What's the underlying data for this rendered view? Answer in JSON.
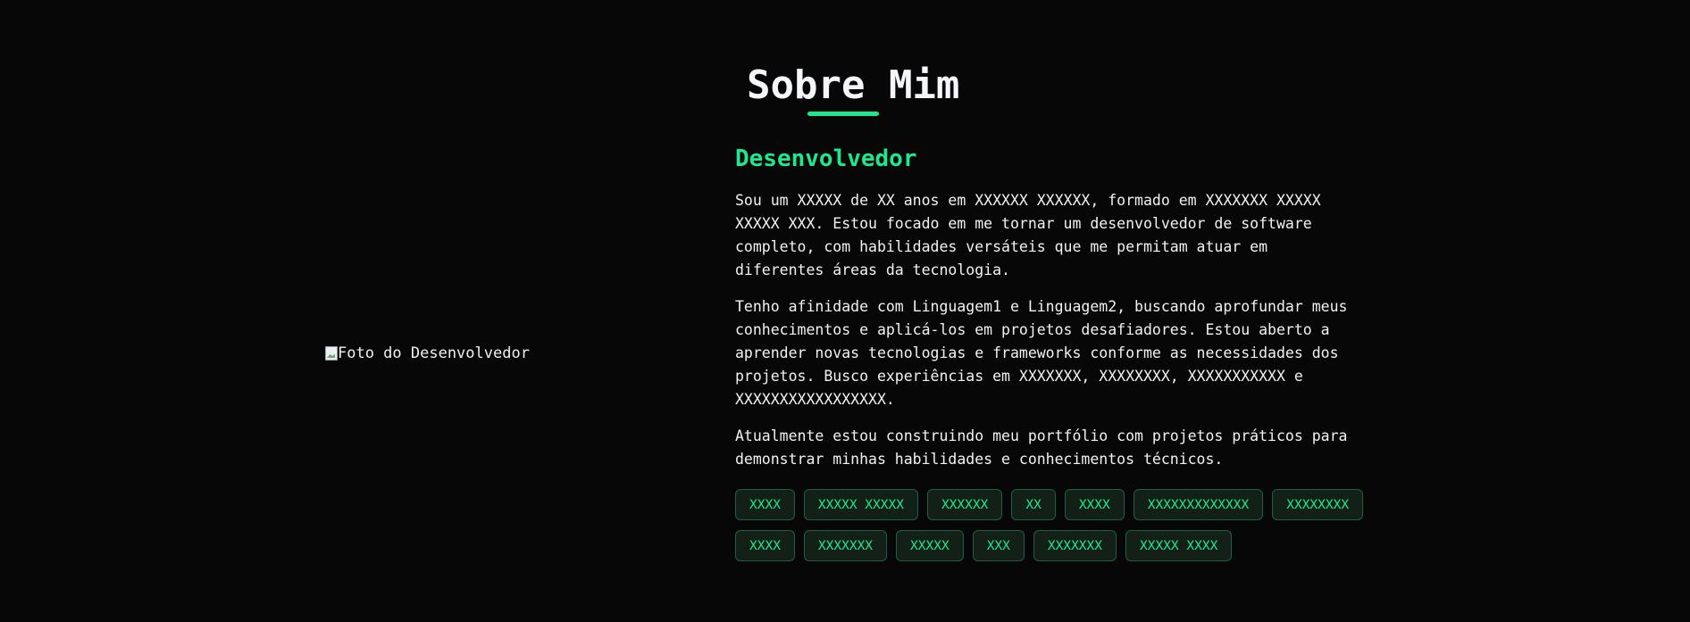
{
  "about": {
    "title": "Sobre Mim",
    "photo_alt": "Foto do Desenvolvedor",
    "subtitle": "Desenvolvedor",
    "paragraphs": [
      "Sou um XXXXX de XX anos em XXXXXX XXXXXX, formado em XXXXXXX XXXXX XXXXX XXX. Estou focado em me tornar um desenvolvedor de software completo, com habilidades versáteis que me permitam atuar em diferentes áreas da tecnologia.",
      "Tenho afinidade com Linguagem1 e Linguagem2, buscando aprofundar meus conhecimentos e aplicá-los em projetos desafiadores. Estou aberto a aprender novas tecnologias e frameworks conforme as necessidades dos projetos. Busco experiências em XXXXXXX, XXXXXXXX, XXXXXXXXXXX e XXXXXXXXXXXXXXXXX.",
      "Atualmente estou construindo meu portfólio com projetos práticos para demonstrar minhas habilidades e conhecimentos técnicos."
    ],
    "skills": [
      "XXXX",
      "XXXXX XXXXX",
      "XXXXXX",
      "XX",
      "XXXX",
      "XXXXXXXXXXXXX",
      "XXXXXXXX",
      "XXXX",
      "XXXXXXX",
      "XXXXX",
      "XXX",
      "XXXXXXX",
      "XXXXX XXXX"
    ]
  },
  "colors": {
    "background": "#070707",
    "accent": "#1ee88f",
    "text": "#f2f2f2",
    "tag_border": "#1f5f45",
    "tag_background": "#132018"
  },
  "icons": {
    "broken_image": "broken-image-icon"
  }
}
